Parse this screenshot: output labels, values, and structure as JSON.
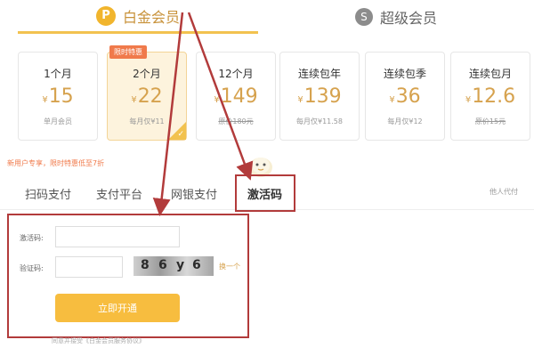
{
  "membership_tabs": [
    {
      "label": "白金会员",
      "icon": "platinum-p-icon",
      "badge": "P",
      "active": true
    },
    {
      "label": "超级会员",
      "icon": "super-s-icon",
      "badge": "S",
      "active": false
    }
  ],
  "plans": [
    {
      "title": "1个月",
      "currency": "¥",
      "price": "15",
      "sub": "单月会员",
      "strike": false,
      "selected": false
    },
    {
      "title": "2个月",
      "currency": "¥",
      "price": "22",
      "sub": "每月仅¥11",
      "strike": false,
      "selected": true,
      "tag": "限时特惠"
    },
    {
      "title": "12个月",
      "currency": "¥",
      "price": "149",
      "sub": "原价180元",
      "strike": true,
      "selected": false
    },
    {
      "title": "连续包年",
      "currency": "¥",
      "price": "139",
      "sub": "每月仅¥11.58",
      "strike": false,
      "selected": false
    },
    {
      "title": "连续包季",
      "currency": "¥",
      "price": "36",
      "sub": "每月仅¥12",
      "strike": false,
      "selected": false
    },
    {
      "title": "连续包月",
      "currency": "¥",
      "price": "12.6",
      "sub": "原价15元",
      "strike": true,
      "selected": false
    }
  ],
  "promo_text": "新用户专享，限时特惠低至7折",
  "payment_tabs": [
    "扫码支付",
    "支付平台",
    "网银支付",
    "激活码"
  ],
  "payment_active_index": 3,
  "other_pay_label": "他人代付",
  "form": {
    "code_label": "激活码:",
    "code_value": "",
    "captcha_label": "验证码:",
    "captcha_value": "",
    "captcha_glyphs": [
      "8",
      "6",
      "y",
      "6"
    ],
    "refresh_label": "换一个",
    "submit_label": "立即开通"
  },
  "agreement_text": "同意并接受《白金会员服务协议》",
  "colors": {
    "accent": "#f2c24f",
    "price": "#d6a24e",
    "highlight_red": "#b23b3b",
    "promo": "#f07a4b"
  }
}
